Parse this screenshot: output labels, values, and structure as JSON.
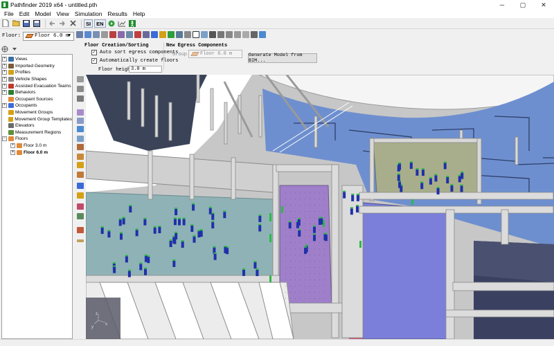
{
  "window": {
    "title": "Pathfinder 2019 x64 - untitled.pth",
    "controls": [
      "─",
      "▢",
      "✕"
    ]
  },
  "menu": [
    "File",
    "Edit",
    "Model",
    "View",
    "Simulation",
    "Results",
    "Help"
  ],
  "toolbar": {
    "units_si": "SI",
    "units_en": "EN",
    "icons": [
      "new-icon",
      "open-icon",
      "save-icon",
      "save-as-icon",
      "undo-icon",
      "redo-icon",
      "delete-icon",
      "units-si",
      "units-en",
      "run-icon",
      "agent-icon"
    ]
  },
  "floor_selector": {
    "label": "Floor:",
    "value": "Floor 6.0 m"
  },
  "tree": {
    "items": [
      {
        "label": "Views",
        "expander": "+",
        "icon_color": "#3a6ea5",
        "child": false,
        "bold": false
      },
      {
        "label": "Imported Geometry",
        "expander": "+",
        "icon_color": "#7a5c3a",
        "child": false,
        "bold": false
      },
      {
        "label": "Profiles",
        "expander": "+",
        "icon_color": "#d4a017",
        "child": false,
        "bold": false
      },
      {
        "label": "Vehicle Shapes",
        "expander": "+",
        "icon_color": "#888888",
        "child": false,
        "bold": false
      },
      {
        "label": "Assisted Evacuation Teams",
        "expander": "+",
        "icon_color": "#c0392b",
        "child": false,
        "bold": false
      },
      {
        "label": "Behaviors",
        "expander": "+",
        "icon_color": "#2e7d32",
        "child": false,
        "bold": false
      },
      {
        "label": "Occupant Sources",
        "expander": "",
        "icon_color": "#e08a3a",
        "child": false,
        "bold": false
      },
      {
        "label": "Occupants",
        "expander": "+",
        "icon_color": "#3f6ad8",
        "child": false,
        "bold": false
      },
      {
        "label": "Movement Groups",
        "expander": "",
        "icon_color": "#d4a017",
        "child": false,
        "bold": false
      },
      {
        "label": "Movement Group Templates",
        "expander": "",
        "icon_color": "#d4a017",
        "child": false,
        "bold": false
      },
      {
        "label": "Elevators",
        "expander": "",
        "icon_color": "#6b6b6b",
        "child": false,
        "bold": false
      },
      {
        "label": "Measurement Regions",
        "expander": "",
        "icon_color": "#5f8f3a",
        "child": false,
        "bold": false
      },
      {
        "label": "Floors",
        "expander": "−",
        "icon_color": "#e08a3a",
        "child": false,
        "bold": false
      },
      {
        "label": "Floor 3.0 m",
        "expander": "+",
        "icon_color": "#e08a3a",
        "child": true,
        "bold": false
      },
      {
        "label": "Floor 6.0 m",
        "expander": "+",
        "icon_color": "#e08a3a",
        "child": true,
        "bold": true
      }
    ]
  },
  "floor_panel": {
    "section_title": "Floor Creation/Sorting",
    "auto_sort_label": "Auto sort egress components",
    "auto_create_label": "Automatically create floors",
    "floor_height_label": "Floor height:",
    "floor_height_value": "3.0 m",
    "egress_title": "New Egress Components",
    "group_label": "Group",
    "group_value": "Floor 6.0 m",
    "generate_button": "Generate Model from BIM..."
  },
  "viewport": {
    "axis_labels": [
      "z",
      "x",
      "y"
    ]
  },
  "colors": {
    "accent": "#1e8a2e",
    "floor_orange": "#e08a3a",
    "room_blue": "#6e8fcf",
    "room_teal": "#8fb2b6",
    "room_purple": "#9f7fc9",
    "room_olive": "#a8ae8c",
    "occupant": "#2030a8",
    "occupant_head": "#2fb84a"
  }
}
